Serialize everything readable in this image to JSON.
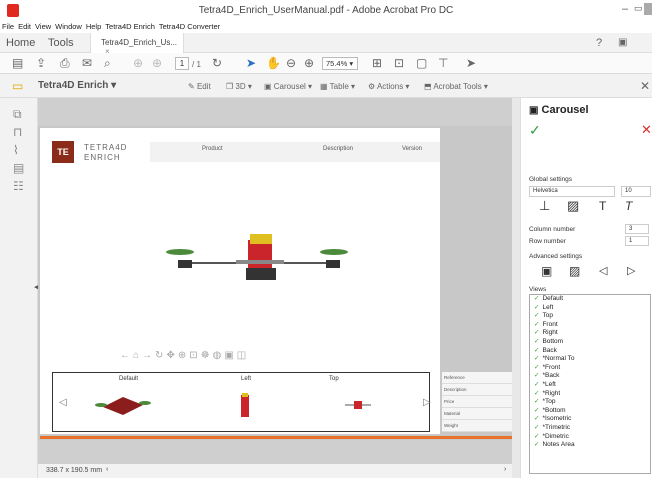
{
  "window": {
    "title": "Tetra4D_Enrich_UserManual.pdf - Adobe Acrobat Pro DC"
  },
  "menu": [
    "File",
    "Edit",
    "View",
    "Window",
    "Help",
    "Tetra4D Enrich",
    "Tetra4D Converter"
  ],
  "tabs": {
    "home": "Home",
    "tools": "Tools",
    "document": "Tetra4D_Enrich_Us...",
    "close": "×"
  },
  "toolbar": {
    "page_current": "1",
    "page_total": "/ 1",
    "zoom": "75.4%"
  },
  "enrich_toolbar": {
    "brand": "Tetra4D Enrich",
    "edit": "Edit",
    "threed": "3D",
    "carousel": "Carousel",
    "table": "Table",
    "actions": "Actions",
    "acrobat_tools": "Acrobat Tools"
  },
  "document": {
    "logo": "TE",
    "brand_line1": "TETRA4D",
    "brand_line2": "ENRICH",
    "columns": [
      "Product",
      "Description",
      "Version"
    ]
  },
  "carousel_views": [
    "Default",
    "Left",
    "Top"
  ],
  "properties_table": [
    "Reference",
    "Description",
    "Price",
    "Material",
    "Weight"
  ],
  "status": {
    "page_size": "338.7 x 190.5 mm"
  },
  "panel": {
    "title": "Carousel",
    "global_settings": "Global settings",
    "font": "Helvetica",
    "font_size": "10",
    "column_number_label": "Column number",
    "column_number": "3",
    "row_number_label": "Row number",
    "row_number": "1",
    "advanced_settings": "Advanced settings",
    "views_label": "Views",
    "views": [
      "Default",
      "Left",
      "Top",
      "Front",
      "Right",
      "Bottom",
      "Back",
      "*Normal To",
      "*Front",
      "*Back",
      "*Left",
      "*Right",
      "*Top",
      "*Bottom",
      "*Isometric",
      "*Trimetric",
      "*Dimetric",
      "Notes Area"
    ]
  },
  "colors": {
    "accent_orange": "#e8712b",
    "check_green": "#2f9e3f",
    "cancel_red": "#d9302c"
  }
}
